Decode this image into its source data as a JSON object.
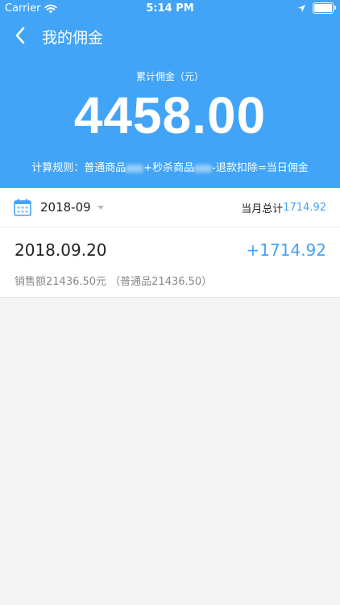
{
  "status_bar": {
    "carrier": "Carrier",
    "time": "5:14 PM",
    "icons": [
      "wifi-icon",
      "location-arrow-icon",
      "battery-icon"
    ]
  },
  "nav": {
    "back_icon": "chevron-left-icon",
    "title": "我的佣金"
  },
  "summary": {
    "label": "累计佣金（元）",
    "total": "4458.00",
    "rule_prefix": "计算规则：普通商品",
    "rule_mid": "+秒杀商品",
    "rule_suffix": "-退款扣除=当日佣金"
  },
  "month_filter": {
    "icon": "calendar-icon",
    "selected": "2018-09",
    "month_total_label": "当月总计",
    "month_total_value": "1714.92"
  },
  "records": [
    {
      "date": "2018.09.20",
      "amount": "+1714.92",
      "detail": "销售额21436.50元 （普通品21436.50）"
    }
  ],
  "colors": {
    "primary": "#42a4f7",
    "background": "#f4f4f4"
  }
}
